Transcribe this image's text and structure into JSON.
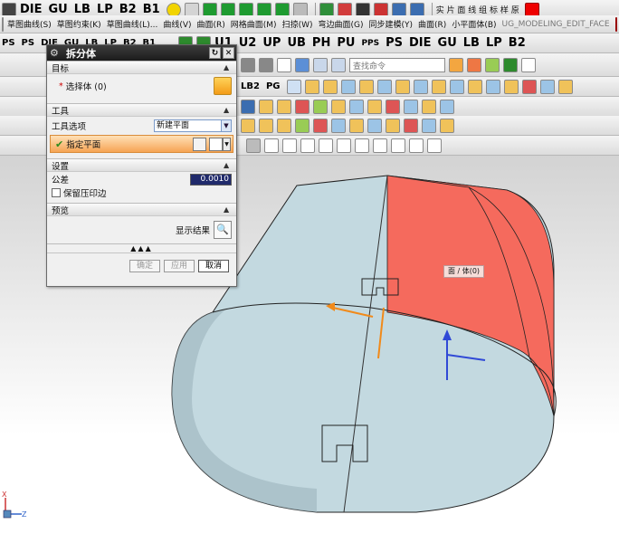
{
  "toolbar_rows": {
    "row1_items": [
      "DIE",
      "GU",
      "LB",
      "LP",
      "B2",
      "B1"
    ],
    "row1_right": [
      "实 片 面 线 组 标 样 原"
    ],
    "row2_items": [
      "草图曲线(S)",
      "草图约束(K)",
      "草图曲线(L)...",
      "曲线(V)",
      "曲面(R)",
      "网格曲面(M)",
      "扫掠(W)",
      "弯边曲面(G)",
      "同步建模(Y)",
      "曲面(R)",
      "小平面体(B)"
    ],
    "row2_code": "UG_MODELING_EDIT_FACE",
    "row3_items": [
      "PS",
      "PS",
      "DIE",
      "GU",
      "LB",
      "LP",
      "B2",
      "B1",
      "U1",
      "U2",
      "UP",
      "UB",
      "PH",
      "PU",
      "PPS",
      "PS",
      "DIE",
      "GU",
      "LB",
      "LP",
      "B2"
    ],
    "search_placeholder": "查找命令",
    "row5_items": [
      "LB2",
      "PG"
    ]
  },
  "dialog": {
    "title": "拆分体",
    "sections": {
      "target": {
        "header": "目标",
        "select_label": "选择体 (0)"
      },
      "tool": {
        "header": "工具",
        "option_label": "工具选项",
        "option_value": "新建平面",
        "specify_plane": "指定平面"
      },
      "settings": {
        "header": "设置",
        "tolerance_label": "公差",
        "tolerance_value": "0.0010",
        "keep_imprint": "保留压印边"
      },
      "preview": {
        "header": "预览",
        "show_result": "显示结果"
      }
    },
    "buttons": {
      "ok": "确定",
      "apply": "应用",
      "cancel": "取消"
    }
  },
  "viewport": {
    "tooltip": "面 / 体(0)",
    "triad": {
      "x": "X",
      "z": "Z"
    },
    "colors": {
      "body": "#c3d9e0",
      "selected_face": "#f56a5d",
      "accent": "#f18a1a"
    }
  }
}
